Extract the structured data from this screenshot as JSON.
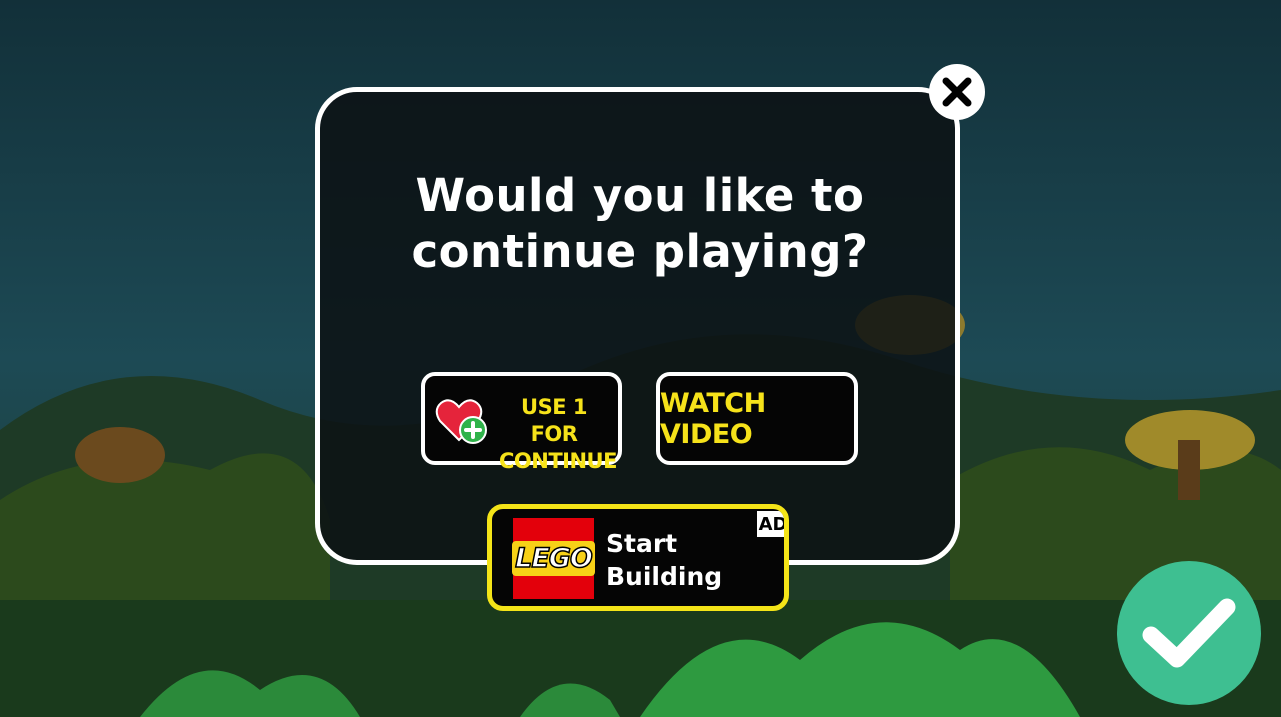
{
  "dialog": {
    "title": "Would you like to continue playing?",
    "use_life_button": {
      "label_line1": "USE 1 FOR",
      "label_line2": "CONTINUE",
      "icon": "heart-plus-icon"
    },
    "watch_video_button": {
      "label": "WATCH VIDEO"
    },
    "close_icon": "close-icon"
  },
  "ad_banner": {
    "brand_logo_text": "LEGO",
    "text_line1": "Start",
    "text_line2": "Building",
    "badge": "AD"
  },
  "confirm_icon": "checkmark-icon",
  "colors": {
    "dialog_border": "#ffffff",
    "button_text": "#f6e21a",
    "ad_border": "#f4e418",
    "lego_red": "#e3000b",
    "confirm_green": "#3ebf91"
  }
}
